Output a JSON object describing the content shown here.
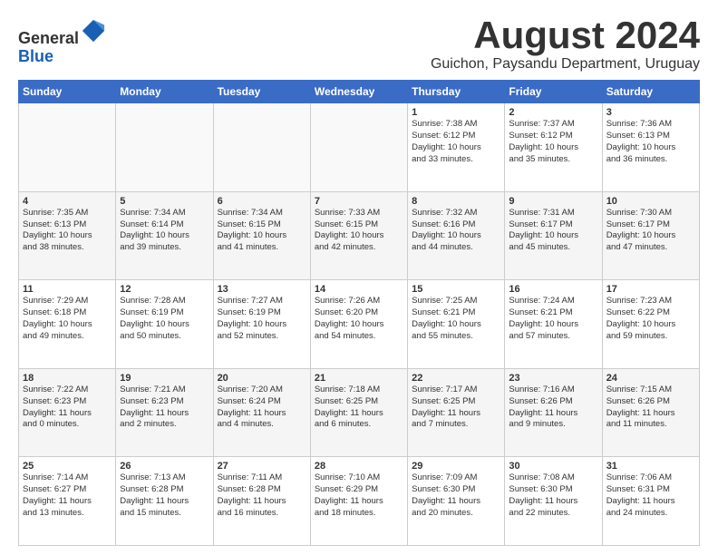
{
  "header": {
    "logo_general": "General",
    "logo_blue": "Blue",
    "month": "August 2024",
    "location": "Guichon, Paysandu Department, Uruguay"
  },
  "weekdays": [
    "Sunday",
    "Monday",
    "Tuesday",
    "Wednesday",
    "Thursday",
    "Friday",
    "Saturday"
  ],
  "weeks": [
    [
      {
        "day": "",
        "info": ""
      },
      {
        "day": "",
        "info": ""
      },
      {
        "day": "",
        "info": ""
      },
      {
        "day": "",
        "info": ""
      },
      {
        "day": "1",
        "info": "Sunrise: 7:38 AM\nSunset: 6:12 PM\nDaylight: 10 hours\nand 33 minutes."
      },
      {
        "day": "2",
        "info": "Sunrise: 7:37 AM\nSunset: 6:12 PM\nDaylight: 10 hours\nand 35 minutes."
      },
      {
        "day": "3",
        "info": "Sunrise: 7:36 AM\nSunset: 6:13 PM\nDaylight: 10 hours\nand 36 minutes."
      }
    ],
    [
      {
        "day": "4",
        "info": "Sunrise: 7:35 AM\nSunset: 6:13 PM\nDaylight: 10 hours\nand 38 minutes."
      },
      {
        "day": "5",
        "info": "Sunrise: 7:34 AM\nSunset: 6:14 PM\nDaylight: 10 hours\nand 39 minutes."
      },
      {
        "day": "6",
        "info": "Sunrise: 7:34 AM\nSunset: 6:15 PM\nDaylight: 10 hours\nand 41 minutes."
      },
      {
        "day": "7",
        "info": "Sunrise: 7:33 AM\nSunset: 6:15 PM\nDaylight: 10 hours\nand 42 minutes."
      },
      {
        "day": "8",
        "info": "Sunrise: 7:32 AM\nSunset: 6:16 PM\nDaylight: 10 hours\nand 44 minutes."
      },
      {
        "day": "9",
        "info": "Sunrise: 7:31 AM\nSunset: 6:17 PM\nDaylight: 10 hours\nand 45 minutes."
      },
      {
        "day": "10",
        "info": "Sunrise: 7:30 AM\nSunset: 6:17 PM\nDaylight: 10 hours\nand 47 minutes."
      }
    ],
    [
      {
        "day": "11",
        "info": "Sunrise: 7:29 AM\nSunset: 6:18 PM\nDaylight: 10 hours\nand 49 minutes."
      },
      {
        "day": "12",
        "info": "Sunrise: 7:28 AM\nSunset: 6:19 PM\nDaylight: 10 hours\nand 50 minutes."
      },
      {
        "day": "13",
        "info": "Sunrise: 7:27 AM\nSunset: 6:19 PM\nDaylight: 10 hours\nand 52 minutes."
      },
      {
        "day": "14",
        "info": "Sunrise: 7:26 AM\nSunset: 6:20 PM\nDaylight: 10 hours\nand 54 minutes."
      },
      {
        "day": "15",
        "info": "Sunrise: 7:25 AM\nSunset: 6:21 PM\nDaylight: 10 hours\nand 55 minutes."
      },
      {
        "day": "16",
        "info": "Sunrise: 7:24 AM\nSunset: 6:21 PM\nDaylight: 10 hours\nand 57 minutes."
      },
      {
        "day": "17",
        "info": "Sunrise: 7:23 AM\nSunset: 6:22 PM\nDaylight: 10 hours\nand 59 minutes."
      }
    ],
    [
      {
        "day": "18",
        "info": "Sunrise: 7:22 AM\nSunset: 6:23 PM\nDaylight: 11 hours\nand 0 minutes."
      },
      {
        "day": "19",
        "info": "Sunrise: 7:21 AM\nSunset: 6:23 PM\nDaylight: 11 hours\nand 2 minutes."
      },
      {
        "day": "20",
        "info": "Sunrise: 7:20 AM\nSunset: 6:24 PM\nDaylight: 11 hours\nand 4 minutes."
      },
      {
        "day": "21",
        "info": "Sunrise: 7:18 AM\nSunset: 6:25 PM\nDaylight: 11 hours\nand 6 minutes."
      },
      {
        "day": "22",
        "info": "Sunrise: 7:17 AM\nSunset: 6:25 PM\nDaylight: 11 hours\nand 7 minutes."
      },
      {
        "day": "23",
        "info": "Sunrise: 7:16 AM\nSunset: 6:26 PM\nDaylight: 11 hours\nand 9 minutes."
      },
      {
        "day": "24",
        "info": "Sunrise: 7:15 AM\nSunset: 6:26 PM\nDaylight: 11 hours\nand 11 minutes."
      }
    ],
    [
      {
        "day": "25",
        "info": "Sunrise: 7:14 AM\nSunset: 6:27 PM\nDaylight: 11 hours\nand 13 minutes."
      },
      {
        "day": "26",
        "info": "Sunrise: 7:13 AM\nSunset: 6:28 PM\nDaylight: 11 hours\nand 15 minutes."
      },
      {
        "day": "27",
        "info": "Sunrise: 7:11 AM\nSunset: 6:28 PM\nDaylight: 11 hours\nand 16 minutes."
      },
      {
        "day": "28",
        "info": "Sunrise: 7:10 AM\nSunset: 6:29 PM\nDaylight: 11 hours\nand 18 minutes."
      },
      {
        "day": "29",
        "info": "Sunrise: 7:09 AM\nSunset: 6:30 PM\nDaylight: 11 hours\nand 20 minutes."
      },
      {
        "day": "30",
        "info": "Sunrise: 7:08 AM\nSunset: 6:30 PM\nDaylight: 11 hours\nand 22 minutes."
      },
      {
        "day": "31",
        "info": "Sunrise: 7:06 AM\nSunset: 6:31 PM\nDaylight: 11 hours\nand 24 minutes."
      }
    ]
  ]
}
